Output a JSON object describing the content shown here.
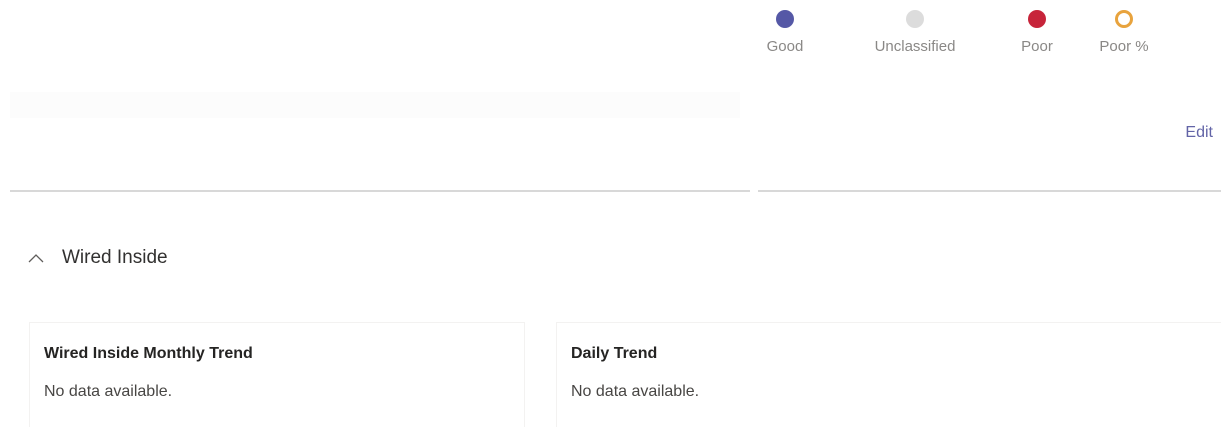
{
  "legend": {
    "items": [
      {
        "label": "Good",
        "color": "#5558a6",
        "style": "filled"
      },
      {
        "label": "Unclassified",
        "color": "#dcdcdc",
        "style": "filled"
      },
      {
        "label": "Poor",
        "color": "#c7243a",
        "style": "filled"
      },
      {
        "label": "Poor %",
        "color": "#e8a33d",
        "style": "ring"
      }
    ]
  },
  "toolbar": {
    "edit_label": "Edit"
  },
  "section": {
    "title": "Wired Inside",
    "expanded": true,
    "icon": "chevron-up-icon"
  },
  "cards": [
    {
      "title": "Wired Inside Monthly Trend",
      "message": "No data available."
    },
    {
      "title": "Daily Trend",
      "message": "No data available."
    }
  ],
  "colors": {
    "accent": "#6264a7"
  }
}
